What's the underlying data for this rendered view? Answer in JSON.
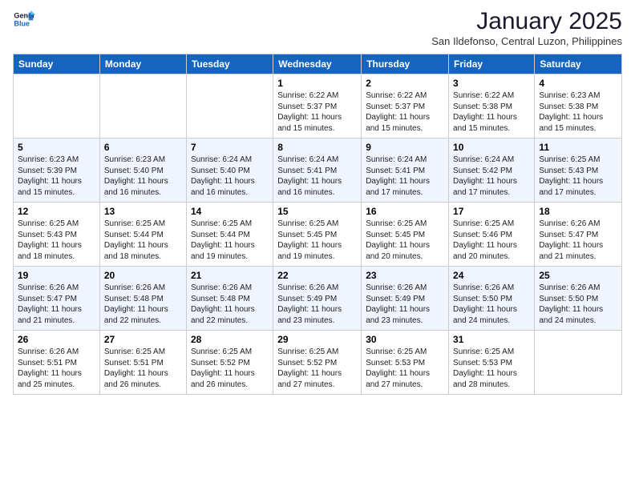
{
  "header": {
    "logo_general": "General",
    "logo_blue": "Blue",
    "month_title": "January 2025",
    "location": "San Ildefonso, Central Luzon, Philippines"
  },
  "days_of_week": [
    "Sunday",
    "Monday",
    "Tuesday",
    "Wednesday",
    "Thursday",
    "Friday",
    "Saturday"
  ],
  "weeks": [
    {
      "days": [
        {
          "num": "",
          "info": ""
        },
        {
          "num": "",
          "info": ""
        },
        {
          "num": "",
          "info": ""
        },
        {
          "num": "1",
          "info": "Sunrise: 6:22 AM\nSunset: 5:37 PM\nDaylight: 11 hours and 15 minutes."
        },
        {
          "num": "2",
          "info": "Sunrise: 6:22 AM\nSunset: 5:37 PM\nDaylight: 11 hours and 15 minutes."
        },
        {
          "num": "3",
          "info": "Sunrise: 6:22 AM\nSunset: 5:38 PM\nDaylight: 11 hours and 15 minutes."
        },
        {
          "num": "4",
          "info": "Sunrise: 6:23 AM\nSunset: 5:38 PM\nDaylight: 11 hours and 15 minutes."
        }
      ]
    },
    {
      "days": [
        {
          "num": "5",
          "info": "Sunrise: 6:23 AM\nSunset: 5:39 PM\nDaylight: 11 hours and 15 minutes."
        },
        {
          "num": "6",
          "info": "Sunrise: 6:23 AM\nSunset: 5:40 PM\nDaylight: 11 hours and 16 minutes."
        },
        {
          "num": "7",
          "info": "Sunrise: 6:24 AM\nSunset: 5:40 PM\nDaylight: 11 hours and 16 minutes."
        },
        {
          "num": "8",
          "info": "Sunrise: 6:24 AM\nSunset: 5:41 PM\nDaylight: 11 hours and 16 minutes."
        },
        {
          "num": "9",
          "info": "Sunrise: 6:24 AM\nSunset: 5:41 PM\nDaylight: 11 hours and 17 minutes."
        },
        {
          "num": "10",
          "info": "Sunrise: 6:24 AM\nSunset: 5:42 PM\nDaylight: 11 hours and 17 minutes."
        },
        {
          "num": "11",
          "info": "Sunrise: 6:25 AM\nSunset: 5:43 PM\nDaylight: 11 hours and 17 minutes."
        }
      ]
    },
    {
      "days": [
        {
          "num": "12",
          "info": "Sunrise: 6:25 AM\nSunset: 5:43 PM\nDaylight: 11 hours and 18 minutes."
        },
        {
          "num": "13",
          "info": "Sunrise: 6:25 AM\nSunset: 5:44 PM\nDaylight: 11 hours and 18 minutes."
        },
        {
          "num": "14",
          "info": "Sunrise: 6:25 AM\nSunset: 5:44 PM\nDaylight: 11 hours and 19 minutes."
        },
        {
          "num": "15",
          "info": "Sunrise: 6:25 AM\nSunset: 5:45 PM\nDaylight: 11 hours and 19 minutes."
        },
        {
          "num": "16",
          "info": "Sunrise: 6:25 AM\nSunset: 5:45 PM\nDaylight: 11 hours and 20 minutes."
        },
        {
          "num": "17",
          "info": "Sunrise: 6:25 AM\nSunset: 5:46 PM\nDaylight: 11 hours and 20 minutes."
        },
        {
          "num": "18",
          "info": "Sunrise: 6:26 AM\nSunset: 5:47 PM\nDaylight: 11 hours and 21 minutes."
        }
      ]
    },
    {
      "days": [
        {
          "num": "19",
          "info": "Sunrise: 6:26 AM\nSunset: 5:47 PM\nDaylight: 11 hours and 21 minutes."
        },
        {
          "num": "20",
          "info": "Sunrise: 6:26 AM\nSunset: 5:48 PM\nDaylight: 11 hours and 22 minutes."
        },
        {
          "num": "21",
          "info": "Sunrise: 6:26 AM\nSunset: 5:48 PM\nDaylight: 11 hours and 22 minutes."
        },
        {
          "num": "22",
          "info": "Sunrise: 6:26 AM\nSunset: 5:49 PM\nDaylight: 11 hours and 23 minutes."
        },
        {
          "num": "23",
          "info": "Sunrise: 6:26 AM\nSunset: 5:49 PM\nDaylight: 11 hours and 23 minutes."
        },
        {
          "num": "24",
          "info": "Sunrise: 6:26 AM\nSunset: 5:50 PM\nDaylight: 11 hours and 24 minutes."
        },
        {
          "num": "25",
          "info": "Sunrise: 6:26 AM\nSunset: 5:50 PM\nDaylight: 11 hours and 24 minutes."
        }
      ]
    },
    {
      "days": [
        {
          "num": "26",
          "info": "Sunrise: 6:26 AM\nSunset: 5:51 PM\nDaylight: 11 hours and 25 minutes."
        },
        {
          "num": "27",
          "info": "Sunrise: 6:25 AM\nSunset: 5:51 PM\nDaylight: 11 hours and 26 minutes."
        },
        {
          "num": "28",
          "info": "Sunrise: 6:25 AM\nSunset: 5:52 PM\nDaylight: 11 hours and 26 minutes."
        },
        {
          "num": "29",
          "info": "Sunrise: 6:25 AM\nSunset: 5:52 PM\nDaylight: 11 hours and 27 minutes."
        },
        {
          "num": "30",
          "info": "Sunrise: 6:25 AM\nSunset: 5:53 PM\nDaylight: 11 hours and 27 minutes."
        },
        {
          "num": "31",
          "info": "Sunrise: 6:25 AM\nSunset: 5:53 PM\nDaylight: 11 hours and 28 minutes."
        },
        {
          "num": "",
          "info": ""
        }
      ]
    }
  ]
}
